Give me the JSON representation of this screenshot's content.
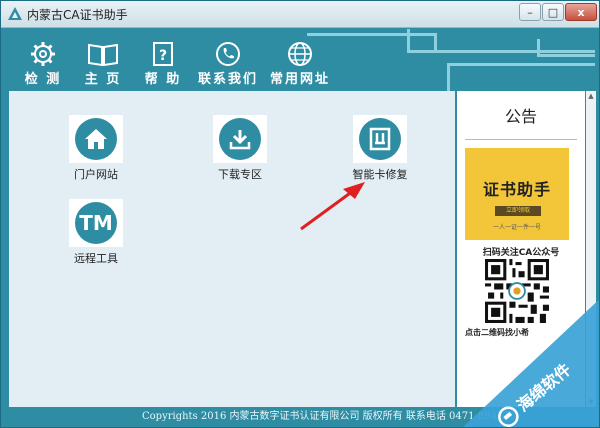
{
  "window": {
    "title": "内蒙古CA证书助手",
    "buttons": {
      "minimize": "–",
      "maximize": "□",
      "close": "x"
    }
  },
  "toolbar": {
    "items": [
      {
        "label": "检 测",
        "icon": "gear-icon"
      },
      {
        "label": "主 页",
        "icon": "book-icon"
      },
      {
        "label": "帮 助",
        "icon": "help-icon"
      },
      {
        "label": "联系我们",
        "icon": "phone-icon"
      },
      {
        "label": "常用网址",
        "icon": "globe-icon"
      }
    ]
  },
  "apps": [
    {
      "label": "门户网站",
      "icon": "home-icon"
    },
    {
      "label": "下载专区",
      "icon": "download-icon"
    },
    {
      "label": "智能卡修复",
      "icon": "card-repair-icon"
    },
    {
      "label": "远程工具",
      "icon": "tm-icon",
      "glyph": "TM"
    }
  ],
  "notice": {
    "title": "公告",
    "banner_title": "证书助手",
    "banner_tag": "立即领取",
    "banner_sub": "一人一证一件一号",
    "scan_text": "扫码关注CA公众号",
    "qr_hint": "点击二维码找小希"
  },
  "footer": {
    "text": "Copyrights 2016 内蒙古数字证书认证有限公司 版权所有   联系电话  0471-894236"
  },
  "watermark": {
    "text": "海绵软件"
  },
  "colors": {
    "teal": "#2f8da3",
    "content_bg": "#e3eef4",
    "banner": "#f3c63a",
    "arrow": "#e02020"
  }
}
